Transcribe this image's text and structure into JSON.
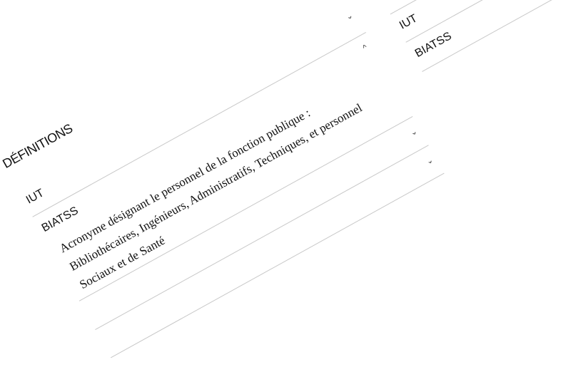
{
  "section_title": "DÉFINITIONS",
  "items": [
    {
      "term": "IUT",
      "expanded": false
    },
    {
      "term": "BIATSS",
      "expanded": true,
      "definition": "Acronyme désignant le personnel de la fonction publique : Bibliothécaires, Ingénieurs, Administratifs, Techniques, et personnel Sociaux et de Santé"
    }
  ],
  "icons": {
    "collapsed": "chevron-down-icon",
    "expanded": "chevron-up-icon"
  },
  "chevron_down": "⌄",
  "chevron_up": "^"
}
